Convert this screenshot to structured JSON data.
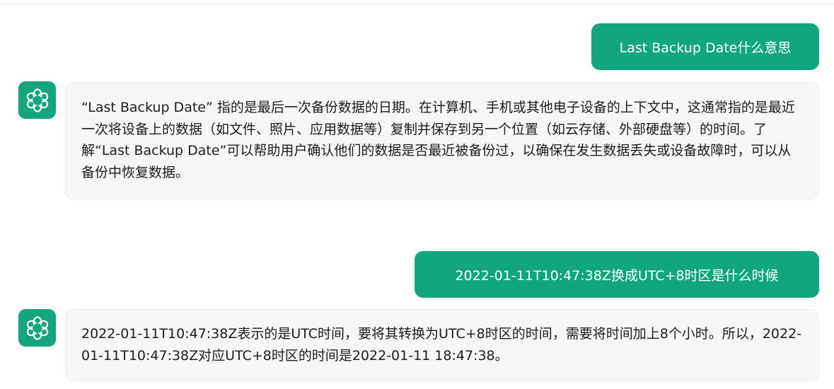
{
  "conversation": {
    "messages": [
      {
        "role": "user",
        "text": "Last Backup Date什么意思"
      },
      {
        "role": "assistant",
        "text": "“Last Backup Date” 指的是最后一次备份数据的日期。在计算机、手机或其他电子设备的上下文中，这通常指的是最近一次将设备上的数据（如文件、照片、应用数据等）复制并保存到另一个位置（如云存储、外部硬盘等）的时间。了解“Last Backup Date”可以帮助用户确认他们的数据是否最近被备份过，以确保在发生数据丢失或设备故障时，可以从备份中恢复数据。"
      },
      {
        "role": "user",
        "text": "2022-01-11T10:47:38Z换成UTC+8时区是什么时候"
      },
      {
        "role": "assistant",
        "text": "2022-01-11T10:47:38Z表示的是UTC时间，要将其转换为UTC+8时区的时间，需要将时间加上8个小时。所以，2022-01-11T10:47:38Z对应UTC+8时区的时间是2022-01-11 18:47:38。"
      }
    ]
  },
  "icons": {
    "assistant_avatar": "openai-logo-icon"
  },
  "colors": {
    "user_bubble": "#12a67f",
    "avatar_bg": "#14a57f",
    "assistant_bubble": "#f7f7f8"
  }
}
